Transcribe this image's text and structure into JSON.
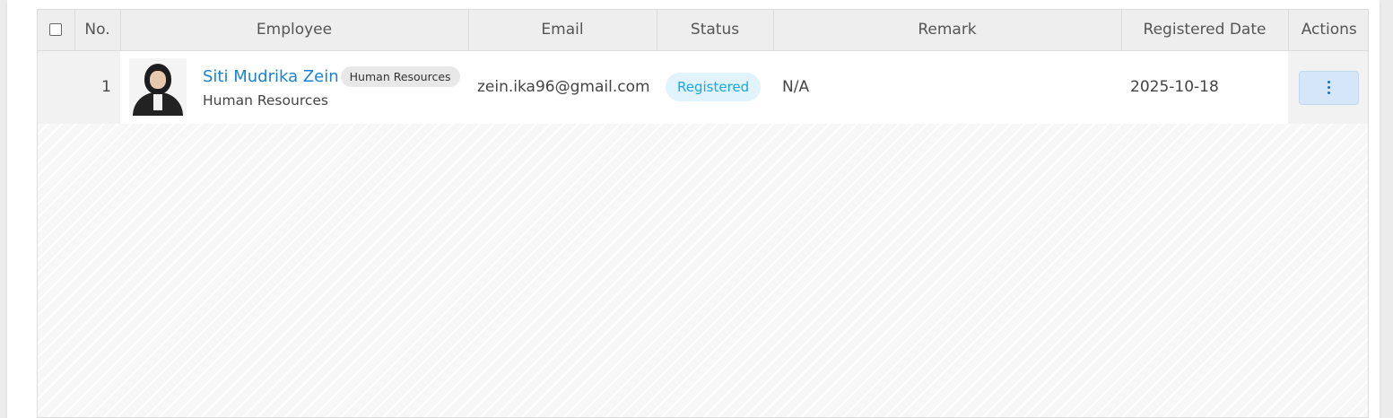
{
  "table": {
    "columns": {
      "no": "No.",
      "employee": "Employee",
      "email": "Email",
      "status": "Status",
      "remark": "Remark",
      "registered_date": "Registered Date",
      "actions": "Actions"
    },
    "rows": [
      {
        "no": "1",
        "name": "Siti Mudrika Zein",
        "department_badge": "Human Resources",
        "department": "Human Resources",
        "email": "zein.ika96@gmail.com",
        "status": "Registered",
        "remark": "N/A",
        "registered_date": "2025-10-18",
        "actions_icon": "kebab-menu-icon"
      }
    ]
  },
  "colors": {
    "name_link": "#1a82d6",
    "status_text": "#1aa6e6",
    "status_bg": "#e1f4fd",
    "action_button_bg": "#d4e6f7"
  }
}
